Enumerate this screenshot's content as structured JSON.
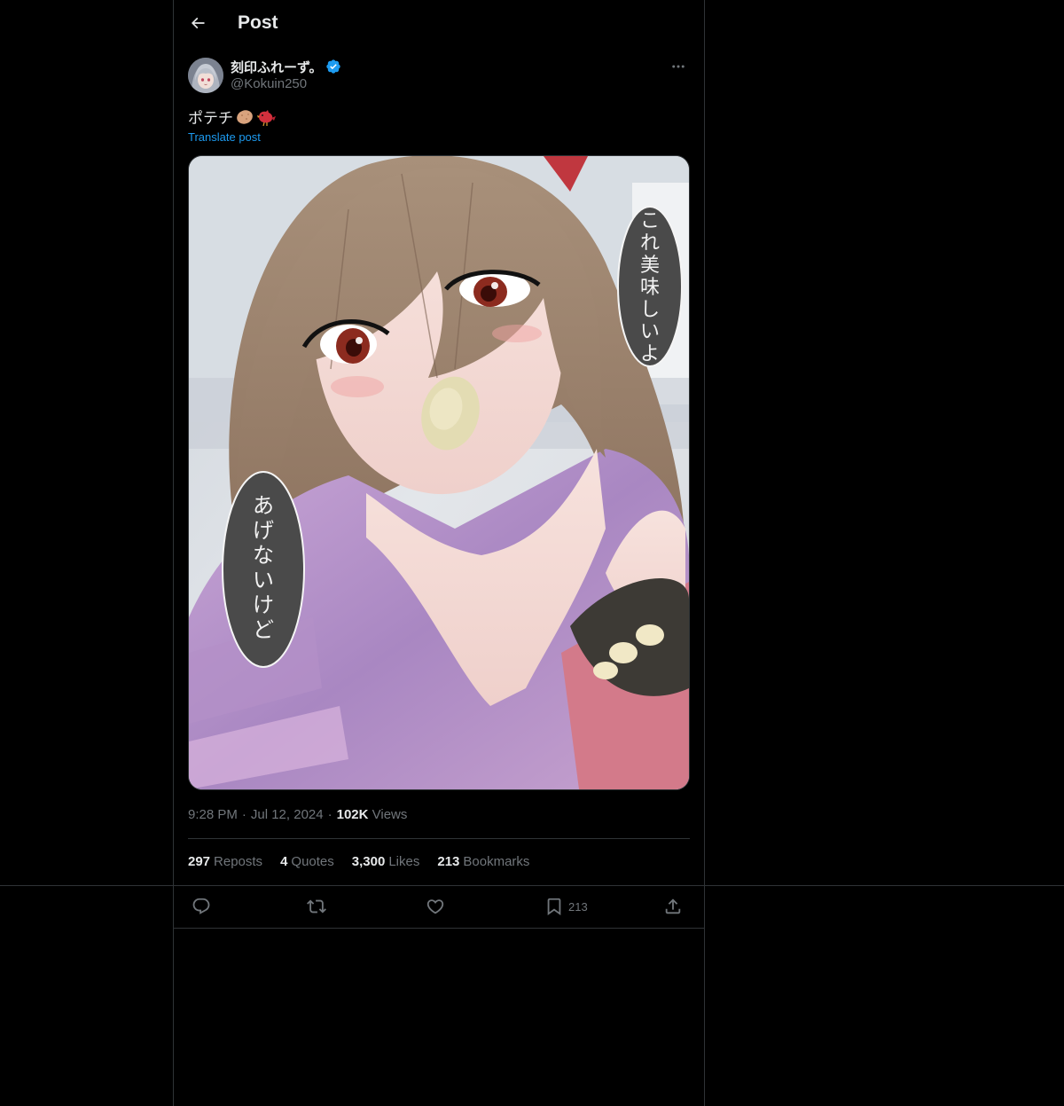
{
  "header": {
    "title": "Post",
    "back_icon": "arrow-left-icon"
  },
  "author": {
    "display_name": "刻印ふれーず。",
    "handle": "@Kokuin250",
    "verified_icon": "verified-badge-icon",
    "verified_color": "#1d9bf0"
  },
  "post": {
    "text": "ポテチ",
    "emoji": [
      "potato-emoji-icon",
      "red-bird-emoji-icon"
    ],
    "translate_label": "Translate post",
    "media": {
      "bubble_right": "これ美味しいよ",
      "bubble_left": "あげないけど"
    }
  },
  "meta": {
    "time": "9:28 PM",
    "date": "Jul 12, 2024",
    "views_count": "102K",
    "views_label": "Views"
  },
  "stats": {
    "reposts_count": "297",
    "reposts_label": "Reposts",
    "quotes_count": "4",
    "quotes_label": "Quotes",
    "likes_count": "3,300",
    "likes_label": "Likes",
    "bookmarks_count": "213",
    "bookmarks_label": "Bookmarks"
  },
  "actions": {
    "reply_icon": "reply-icon",
    "repost_icon": "repost-icon",
    "like_icon": "heart-icon",
    "bookmark_icon": "bookmark-icon",
    "bookmark_count": "213",
    "share_icon": "share-icon"
  },
  "colors": {
    "background": "#000000",
    "text_primary": "#e7e9ea",
    "text_secondary": "#71767b",
    "link": "#1d9bf0",
    "border": "#2f3336"
  }
}
